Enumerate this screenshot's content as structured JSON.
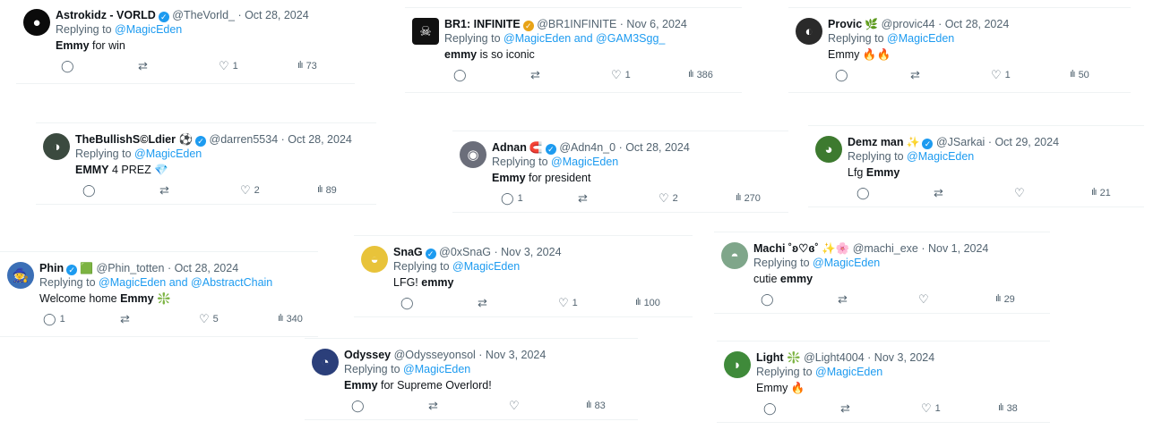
{
  "tweets": [
    {
      "name": "Astrokidz - VORLD",
      "handle": "@TheVorld_",
      "date": "· Oct 28, 2024",
      "reply_prefix": "Replying to",
      "reply_to": "@MagicEden",
      "text_bold": "Emmy",
      "text_rest": " for win",
      "reply_count": "",
      "retweet_count": "",
      "like_count": "1",
      "view_count": "73",
      "avatar_icon": "astrokidz-logo",
      "avatar_color": "#0b0b0b",
      "avatar_glyph": "●",
      "badges": [
        "verified-badge"
      ]
    },
    {
      "name": "BR1: INFINITE",
      "handle": "@BR1INFINITE",
      "date": "· Nov 6, 2024",
      "reply_prefix": "Replying to",
      "reply_to": "@MagicEden and @GAM3Sgg_",
      "text_bold": "emmy",
      "text_rest": " is so iconic",
      "reply_count": "",
      "retweet_count": "",
      "like_count": "1",
      "view_count": "386",
      "avatar_icon": "skull-icon",
      "avatar_color": "#111111",
      "avatar_glyph": "☠",
      "badges": [
        "gold-verified-badge"
      ]
    },
    {
      "name": "Provic",
      "handle": "@provic44",
      "date": "· Oct 28, 2024",
      "reply_prefix": "Replying to",
      "reply_to": "@MagicEden",
      "text_bold": "",
      "text_rest": "Emmy 🔥🔥",
      "reply_count": "",
      "retweet_count": "",
      "like_count": "1",
      "view_count": "50",
      "avatar_icon": "user-avatar",
      "avatar_color": "#2a2a2a",
      "avatar_glyph": "◐",
      "badges": [
        "seedling-emoji"
      ]
    },
    {
      "name": "TheBullishS©Ldier ⚽",
      "handle": "@darren5534",
      "date": "· Oct 28, 2024",
      "reply_prefix": "Replying to",
      "reply_to": "@MagicEden",
      "text_bold": "EMMY",
      "text_rest": " 4 PREZ 💎",
      "reply_count": "",
      "retweet_count": "",
      "like_count": "2",
      "view_count": "89",
      "avatar_icon": "user-avatar",
      "avatar_color": "#3b4a3f",
      "avatar_glyph": "◑",
      "badges": [
        "verified-badge"
      ]
    },
    {
      "name": "Adnan",
      "handle": "@Adn4n_0",
      "date": "· Oct 28, 2024",
      "reply_prefix": "Replying to",
      "reply_to": "@MagicEden",
      "text_bold": "Emmy",
      "text_rest": " for president",
      "reply_count": "1",
      "retweet_count": "",
      "like_count": "2",
      "view_count": "270",
      "avatar_icon": "user-avatar",
      "avatar_color": "#6b6e7a",
      "avatar_glyph": "◉",
      "badges": [
        "magnet-emoji",
        "verified-badge"
      ]
    },
    {
      "name": "Demz man",
      "handle": "@JSarkai",
      "date": "· Oct 29, 2024",
      "reply_prefix": "Replying to",
      "reply_to": "@MagicEden",
      "text_bold": "Emmy",
      "text_rest": "",
      "text_lead": "Lfg ",
      "reply_count": "",
      "retweet_count": "",
      "like_count": "",
      "view_count": "21",
      "avatar_icon": "user-avatar",
      "avatar_color": "#3d7a2f",
      "avatar_glyph": "◕",
      "badges": [
        "sparkles-emoji",
        "verified-badge"
      ]
    },
    {
      "name": "Phin",
      "handle": "@Phin_totten",
      "date": "· Oct 28, 2024",
      "reply_prefix": "Replying to",
      "reply_to": "@MagicEden and @AbstractChain",
      "text_lead": "Welcome home ",
      "text_bold": "Emmy",
      "text_rest": " ❇️",
      "reply_count": "1",
      "retweet_count": "",
      "like_count": "5",
      "view_count": "340",
      "avatar_icon": "wizard-avatar",
      "avatar_color": "#3b6fb6",
      "avatar_glyph": "🧙",
      "badges": [
        "verified-badge",
        "square-emoji"
      ]
    },
    {
      "name": "SnaG",
      "handle": "@0xSnaG",
      "date": "· Nov 3, 2024",
      "reply_prefix": "Replying to",
      "reply_to": "@MagicEden",
      "text_lead": "LFG! ",
      "text_bold": "emmy",
      "text_rest": "",
      "reply_count": "",
      "retweet_count": "",
      "like_count": "1",
      "view_count": "100",
      "avatar_icon": "user-avatar",
      "avatar_color": "#e8c33a",
      "avatar_glyph": "◒",
      "badges": [
        "verified-badge"
      ]
    },
    {
      "name": "Machi ˚ʚ♡ɞ˚ ✨🌸",
      "handle": "@machi_exe",
      "date": "· Nov 1, 2024",
      "reply_prefix": "Replying to",
      "reply_to": "@MagicEden",
      "text_lead": "cutie ",
      "text_bold": "emmy",
      "text_rest": "",
      "reply_count": "",
      "retweet_count": "",
      "like_count": "",
      "view_count": "29",
      "avatar_icon": "user-avatar",
      "avatar_color": "#7fa68a",
      "avatar_glyph": "◓",
      "badges": []
    },
    {
      "name": "Odyssey",
      "handle": "@Odysseyonsol",
      "date": "· Nov 3, 2024",
      "reply_prefix": "Replying to",
      "reply_to": "@MagicEden",
      "text_bold": "Emmy",
      "text_rest": " for Supreme Overlord!",
      "reply_count": "",
      "retweet_count": "",
      "like_count": "",
      "view_count": "83",
      "avatar_icon": "user-avatar",
      "avatar_color": "#2b3f7a",
      "avatar_glyph": "◔",
      "badges": []
    },
    {
      "name": "Light ❇️",
      "handle": "@Light4004",
      "date": "· Nov 3, 2024",
      "reply_prefix": "Replying to",
      "reply_to": "@MagicEden",
      "text_lead": "Emmy ",
      "text_bold": "",
      "text_rest": "🔥",
      "reply_count": "",
      "retweet_count": "",
      "like_count": "1",
      "view_count": "38",
      "avatar_icon": "user-avatar",
      "avatar_color": "#3f8a3a",
      "avatar_glyph": "◗",
      "badges": []
    }
  ]
}
